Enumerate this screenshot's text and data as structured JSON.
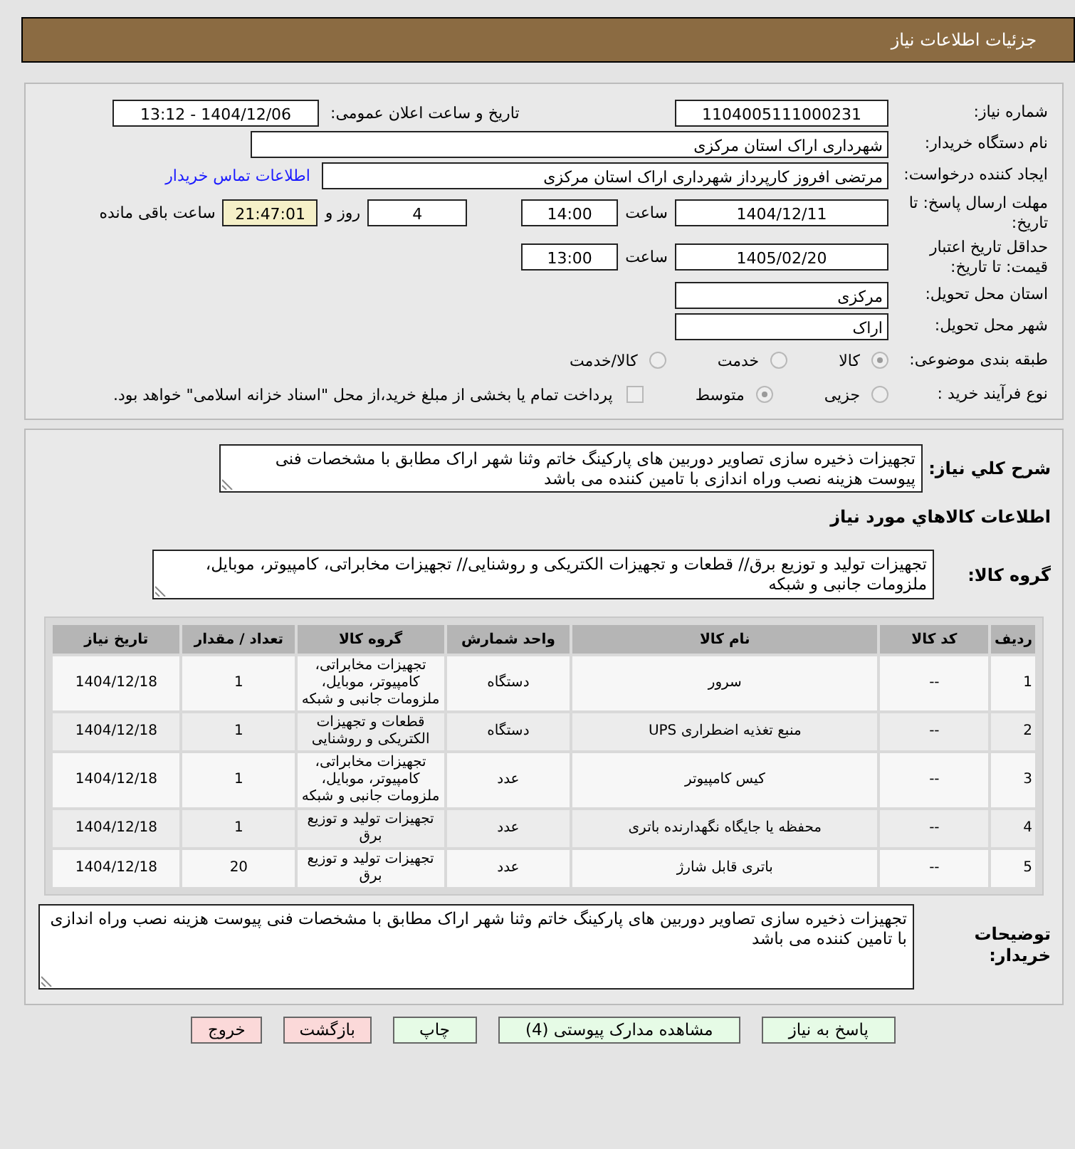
{
  "header": {
    "title": "جزئیات اطلاعات نیاز"
  },
  "form": {
    "need_number": {
      "label": "شماره نیاز:",
      "value": "1104005111000231"
    },
    "announce": {
      "label": "تاریخ و ساعت اعلان عمومی:",
      "value": "1404/12/06 - 13:12"
    },
    "buyer": {
      "label": "نام دستگاه خریدار:",
      "value": "شهرداری اراک استان مرکزی"
    },
    "requester": {
      "label": "ایجاد کننده درخواست:",
      "value": "مرتضی افروز کارپرداز شهرداری اراک استان مرکزی",
      "link": "اطلاعات تماس خریدار"
    },
    "reply_deadline": {
      "label": "مهلت ارسال پاسخ: تا تاریخ:",
      "date": "1404/12/11",
      "time_label": "ساعت",
      "time": "14:00",
      "days": "4",
      "days_label": "روز و",
      "remaining": "21:47:01",
      "remaining_label": "ساعت باقی مانده"
    },
    "price_validity": {
      "label": "حداقل تاریخ اعتبار قیمت: تا تاریخ:",
      "date": "1405/02/20",
      "time_label": "ساعت",
      "time": "13:00"
    },
    "province": {
      "label": "استان محل تحویل:",
      "value": "مرکزی"
    },
    "city": {
      "label": "شهر محل تحویل:",
      "value": "اراک"
    },
    "category": {
      "label": "طبقه بندی موضوعی:",
      "options": [
        {
          "label": "کالا",
          "selected": true
        },
        {
          "label": "خدمت",
          "selected": false
        },
        {
          "label": "کالا/خدمت",
          "selected": false
        }
      ]
    },
    "purchase_type": {
      "label": "نوع فرآیند خرید :",
      "options": [
        {
          "label": "جزیی",
          "selected": false
        },
        {
          "label": "متوسط",
          "selected": true
        }
      ],
      "payment": {
        "checked": false,
        "text": "پرداخت تمام یا بخشی از مبلغ خرید،از محل \"اسناد خزانه اسلامی\" خواهد بود."
      }
    }
  },
  "details": {
    "description": {
      "label": "شرح کلي نياز:",
      "value": "تجهیزات ذخیره سازی تصاویر دوربین های پارکینگ خاتم وثنا شهر اراک مطابق با مشخصات فنی پیوست هزینه نصب وراه اندازی با تامین کننده می باشد"
    },
    "items_title": "اطلاعات کالاهاي مورد نياز",
    "goods_group": {
      "label": "گروه کالا:",
      "value": "تجهیزات تولید و توزیع برق// قطعات و تجهیزات الکتریکی و روشنایی// تجهیزات مخابراتی، کامپیوتر، موبایل، ملزومات جانبی و شبکه"
    },
    "table": {
      "columns": [
        "ردیف",
        "کد کالا",
        "نام کالا",
        "واحد شمارش",
        "گروه کالا",
        "تعداد / مقدار",
        "تاریخ نیاز"
      ],
      "rows": [
        [
          "1",
          "--",
          "سرور",
          "دستگاه",
          "تجهیزات مخابراتی، کامپیوتر، موبایل، ملزومات جانبی و شبکه",
          "1",
          "1404/12/18"
        ],
        [
          "2",
          "--",
          "منبع تغذیه اضطراری UPS",
          "دستگاه",
          "قطعات و تجهیزات الکتریکی و روشنایی",
          "1",
          "1404/12/18"
        ],
        [
          "3",
          "--",
          "کیس کامپیوتر",
          "عدد",
          "تجهیزات مخابراتی، کامپیوتر، موبایل، ملزومات جانبی و شبکه",
          "1",
          "1404/12/18"
        ],
        [
          "4",
          "--",
          "محفظه یا جایگاه نگهدارنده باتری",
          "عدد",
          "تجهیزات تولید و توزیع برق",
          "1",
          "1404/12/18"
        ],
        [
          "5",
          "--",
          "باتری قابل شارژ",
          "عدد",
          "تجهیزات تولید و توزیع برق",
          "20",
          "1404/12/18"
        ]
      ]
    },
    "buyer_notes": {
      "label": "توضیحات خریدار:",
      "value": "تجهیزات ذخیره سازی تصاویر دوربین های پارکینگ خاتم وثنا شهر اراک مطابق با مشخصات فنی پیوست هزینه نصب وراه اندازی با تامین کننده می باشد"
    }
  },
  "buttons": [
    {
      "label": "پاسخ به نیاز",
      "kind": "action"
    },
    {
      "label": "مشاهده مدارک پیوستی (4)",
      "kind": "action"
    },
    {
      "label": "چاپ",
      "kind": "action"
    },
    {
      "label": "بازگشت",
      "kind": "exit"
    },
    {
      "label": "خروج",
      "kind": "exit"
    }
  ]
}
